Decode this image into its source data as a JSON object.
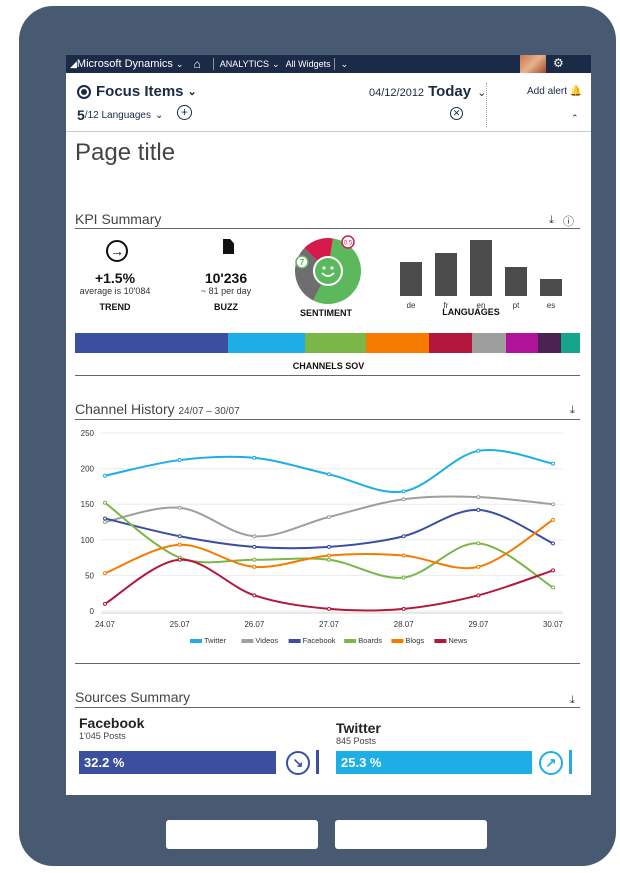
{
  "topbar": {
    "app_name": "Microsoft Dynamics",
    "home_icon": "home-icon",
    "analytics_label": "ANALYTICS",
    "widgets_label": "All Widgets",
    "settings_icon": "gear-icon"
  },
  "header": {
    "focus_label": "Focus Items",
    "languages_count": "5",
    "languages_total": "/12 Languages",
    "date": "04/12/2012",
    "date_range": "Today",
    "add_alert": "Add alert"
  },
  "page_title": "Page title",
  "kpi_summary": {
    "title": "KPI Summary",
    "trend": {
      "value": "+1.5%",
      "sub": "average is 10'084",
      "label": "TREND"
    },
    "buzz": {
      "value": "10'236",
      "sub": "~ 81 per day",
      "label": "BUZZ"
    },
    "sentiment": {
      "label": "SENTIMENT",
      "positive_value": "7",
      "negative_value": "0.5",
      "slices": [
        {
          "name": "positive",
          "fraction": 0.55,
          "color": "#5cb85c"
        },
        {
          "name": "neutral",
          "fraction": 0.3,
          "color": "#6e6e6e"
        },
        {
          "name": "negative",
          "fraction": 0.15,
          "color": "#d6194b"
        }
      ]
    },
    "languages": {
      "label": "LANGUAGES",
      "items": [
        {
          "code": "de",
          "value": 35
        },
        {
          "code": "fr",
          "value": 45
        },
        {
          "code": "en",
          "value": 58
        },
        {
          "code": "pt",
          "value": 30
        },
        {
          "code": "es",
          "value": 18
        }
      ]
    },
    "channels": {
      "label": "CHANNELS SOV",
      "segments": [
        {
          "color": "#3a4fa0",
          "share": 29
        },
        {
          "color": "#1eaee6",
          "share": 14.5
        },
        {
          "color": "#7ab648",
          "share": 11.5
        },
        {
          "color": "#f57c00",
          "share": 12
        },
        {
          "color": "#b3183c",
          "share": 8
        },
        {
          "color": "#9e9e9e",
          "share": 6.5
        },
        {
          "color": "#b0139a",
          "share": 6
        },
        {
          "color": "#4a2350",
          "share": 4.5
        },
        {
          "color": "#14a58a",
          "share": 3.5
        }
      ]
    }
  },
  "channel_history": {
    "title": "Channel History",
    "range": "24/07 – 30/07"
  },
  "chart_data": {
    "type": "line",
    "x": [
      "24.07",
      "25.07",
      "26.07",
      "27.07",
      "28.07",
      "29.07",
      "30.07"
    ],
    "ylim": [
      0,
      250
    ],
    "yticks": [
      0,
      50,
      100,
      150,
      200,
      250
    ],
    "series": [
      {
        "name": "Twitter",
        "color": "#1eaee6",
        "values": [
          190,
          212,
          215,
          192,
          168,
          225,
          207
        ]
      },
      {
        "name": "Videos",
        "color": "#9e9e9e",
        "values": [
          125,
          145,
          105,
          132,
          157,
          160,
          150
        ]
      },
      {
        "name": "Facebook",
        "color": "#3a4fa0",
        "values": [
          130,
          105,
          90,
          90,
          105,
          142,
          95
        ]
      },
      {
        "name": "Boards",
        "color": "#7ab648",
        "values": [
          152,
          75,
          72,
          72,
          47,
          95,
          33
        ]
      },
      {
        "name": "Blogs",
        "color": "#f57c00",
        "values": [
          53,
          93,
          62,
          78,
          78,
          62,
          128
        ]
      },
      {
        "name": "News",
        "color": "#b3183c",
        "values": [
          10,
          72,
          22,
          3,
          3,
          22,
          57
        ]
      }
    ]
  },
  "sources": {
    "title": "Sources Summary",
    "items": [
      {
        "name": "Facebook",
        "posts": "1'045 Posts",
        "percent": "32.2 %",
        "color": "#3a4fa0",
        "trend_icon": "arrow-down-right-icon",
        "arrow": "↘"
      },
      {
        "name": "Twitter",
        "posts": "845 Posts",
        "percent": "25.3 %",
        "color": "#1eaee6",
        "trend_icon": "arrow-up-right-icon",
        "arrow": "↗"
      }
    ]
  }
}
